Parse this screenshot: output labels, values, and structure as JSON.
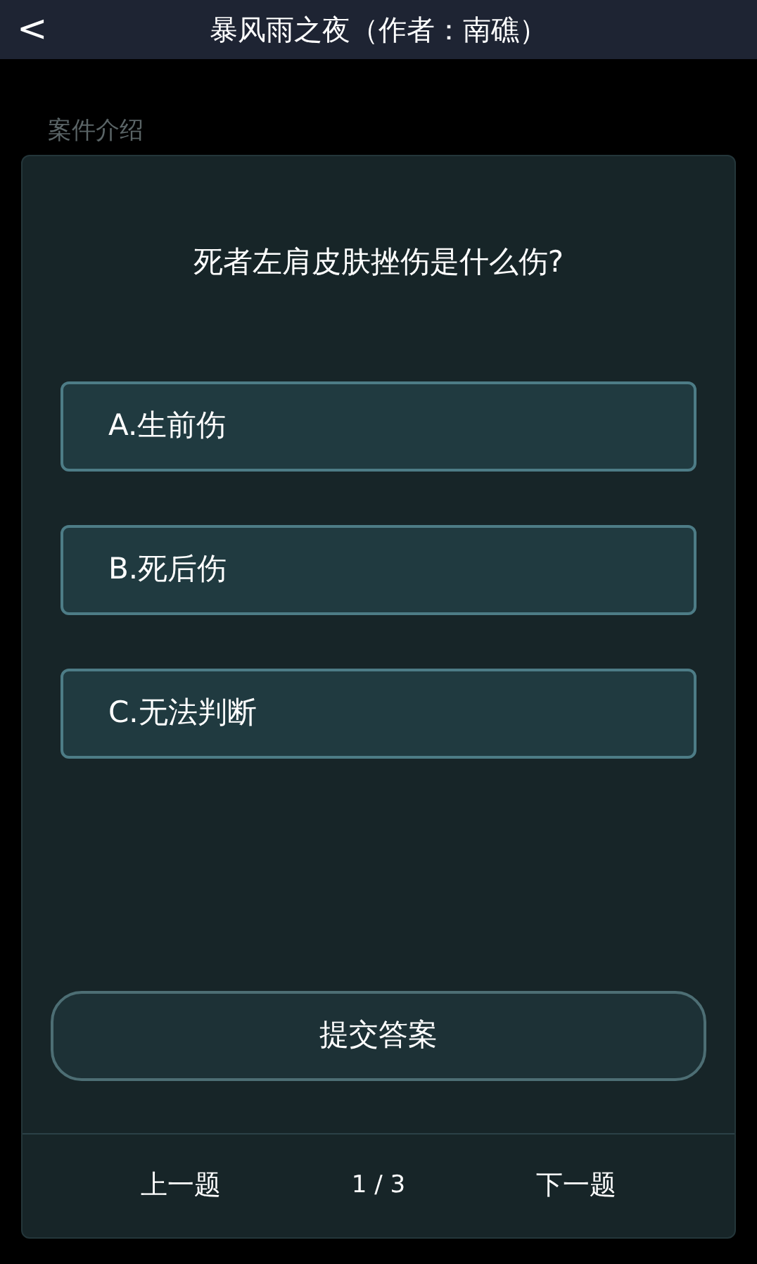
{
  "header": {
    "back": "<",
    "title": "暴风雨之夜（作者：南礁）"
  },
  "background": {
    "tab": "案件介绍"
  },
  "quiz": {
    "question": "死者左肩皮肤挫伤是什么伤?",
    "options": [
      {
        "label": "A.生前伤",
        "selected": false
      },
      {
        "label": "B.死后伤",
        "selected": false
      },
      {
        "label": "C.无法判断",
        "selected": false
      }
    ],
    "submit": "提交答案",
    "prev": "上一题",
    "progress": "1 / 3",
    "next": "下一题"
  }
}
